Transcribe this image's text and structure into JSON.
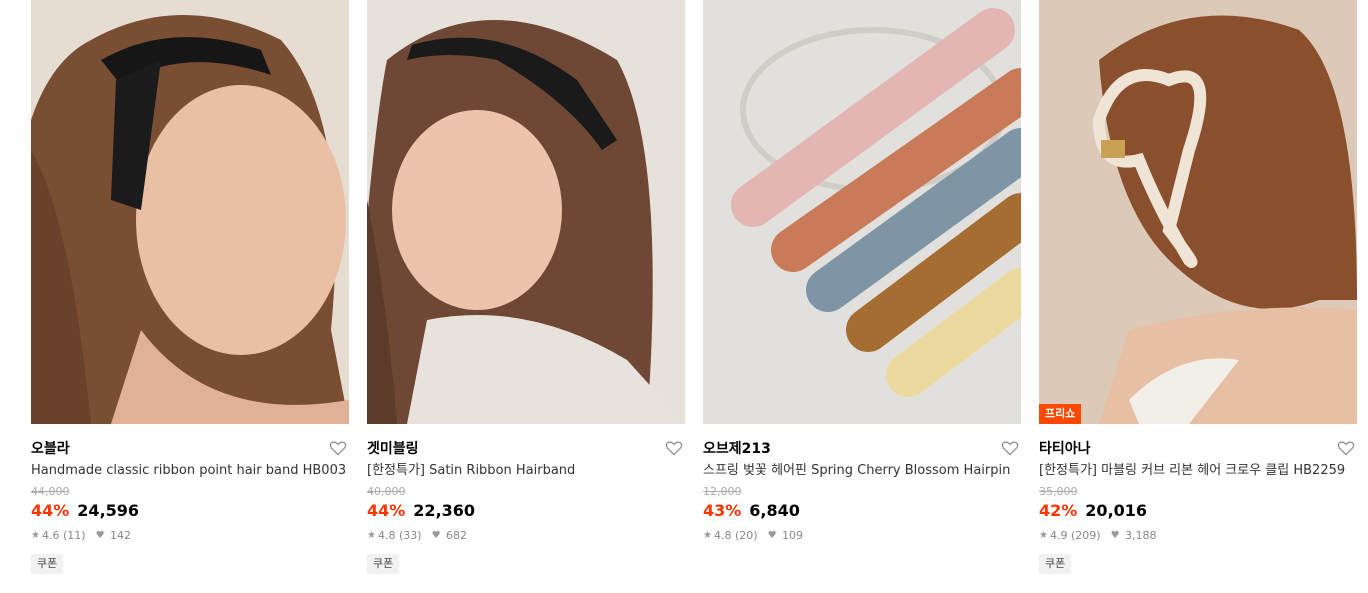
{
  "products": [
    {
      "brand": "오블라",
      "title": "Handmade classic ribbon point hair band HB003",
      "original_price": "44,000",
      "discount": "44%",
      "price": "24,596",
      "rating": "4.6",
      "reviews": "(11)",
      "likes": "142",
      "coupon": "쿠폰",
      "image_icon": "product-photo-headband-black-ribbon"
    },
    {
      "brand": "겟미블링",
      "title": "[한정특가] Satin Ribbon Hairband",
      "original_price": "40,000",
      "discount": "44%",
      "price": "22,360",
      "rating": "4.8",
      "reviews": "(33)",
      "likes": "682",
      "coupon": "쿠폰",
      "image_icon": "product-photo-satin-hairband"
    },
    {
      "brand": "오브제213",
      "title": "스프링 벚꽃 헤어핀 Spring Cherry Blossom Hairpin",
      "original_price": "12,000",
      "discount": "43%",
      "price": "6,840",
      "rating": "4.8",
      "reviews": "(20)",
      "likes": "109",
      "coupon": "",
      "image_icon": "product-photo-hairpins"
    },
    {
      "brand": "타티아나",
      "title": "[한정특가] 마블링 커브 리본 헤어 크로우 클립 HB2259",
      "original_price": "35,000",
      "discount": "42%",
      "price": "20,016",
      "rating": "4.9",
      "reviews": "(209)",
      "likes": "3,188",
      "coupon": "쿠폰",
      "badge": "프리쇼",
      "image_icon": "product-photo-claw-clip"
    }
  ],
  "colors": {
    "discount": "#ff3300",
    "badge": "#ff4800"
  }
}
